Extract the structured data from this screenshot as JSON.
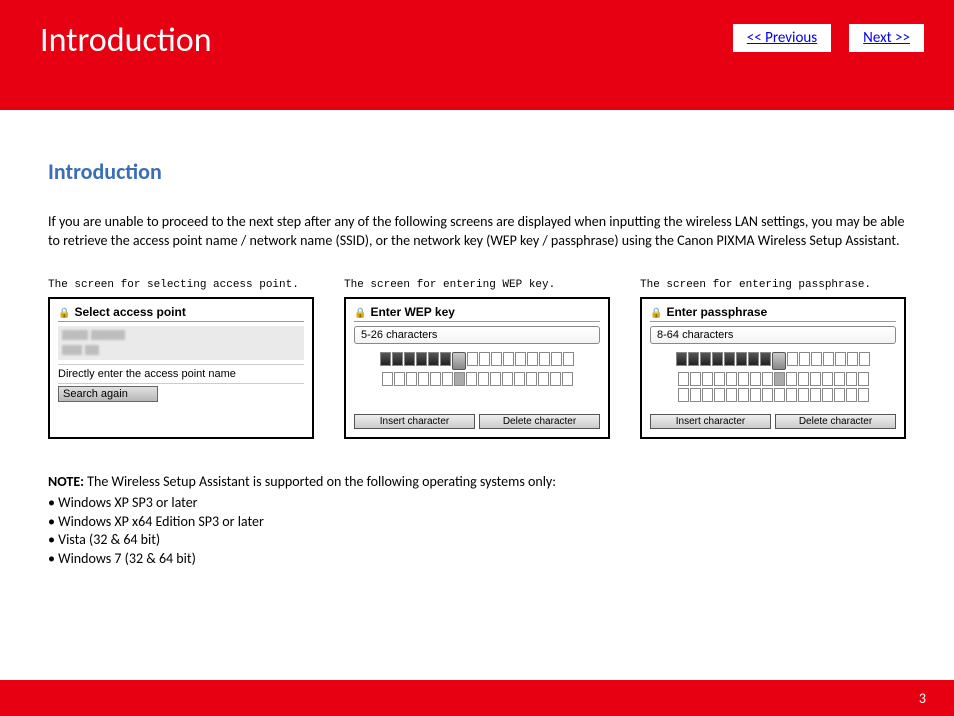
{
  "header": {
    "title": "Introduction",
    "previous": "<< Previous",
    "next": "Next >>"
  },
  "section_title": "Introduction",
  "intro_paragraph": "If you are unable to proceed to the next step after any of the following screens are displayed when inputting the wireless LAN settings, you may be able to retrieve the access point name / network name (SSID), or the network key (WEP key / passphrase) using the Canon PIXMA Wireless Setup Assistant.",
  "figures": {
    "access_point": {
      "caption": "The screen for selecting access point.",
      "title": "Select access point",
      "direct_entry": "Directly enter the access point name",
      "search_button": "Search again"
    },
    "wep": {
      "caption": "The screen for entering WEP key.",
      "title": "Enter WEP key",
      "input_hint": "5-26 characters",
      "insert": "Insert character",
      "delete": "Delete character"
    },
    "passphrase": {
      "caption": "The screen for entering passphrase.",
      "title": "Enter passphrase",
      "input_hint": "8-64 characters",
      "insert": "Insert character",
      "delete": "Delete character"
    }
  },
  "note": {
    "label": "NOTE:",
    "text": "  The Wireless Setup Assistant is supported on the following operating systems only:",
    "items": [
      "Windows XP SP3 or later",
      "Windows XP x64 Edition SP3 or later",
      "Vista (32 & 64 bit)",
      "Windows 7 (32 & 64 bit)"
    ]
  },
  "page_number": "3"
}
